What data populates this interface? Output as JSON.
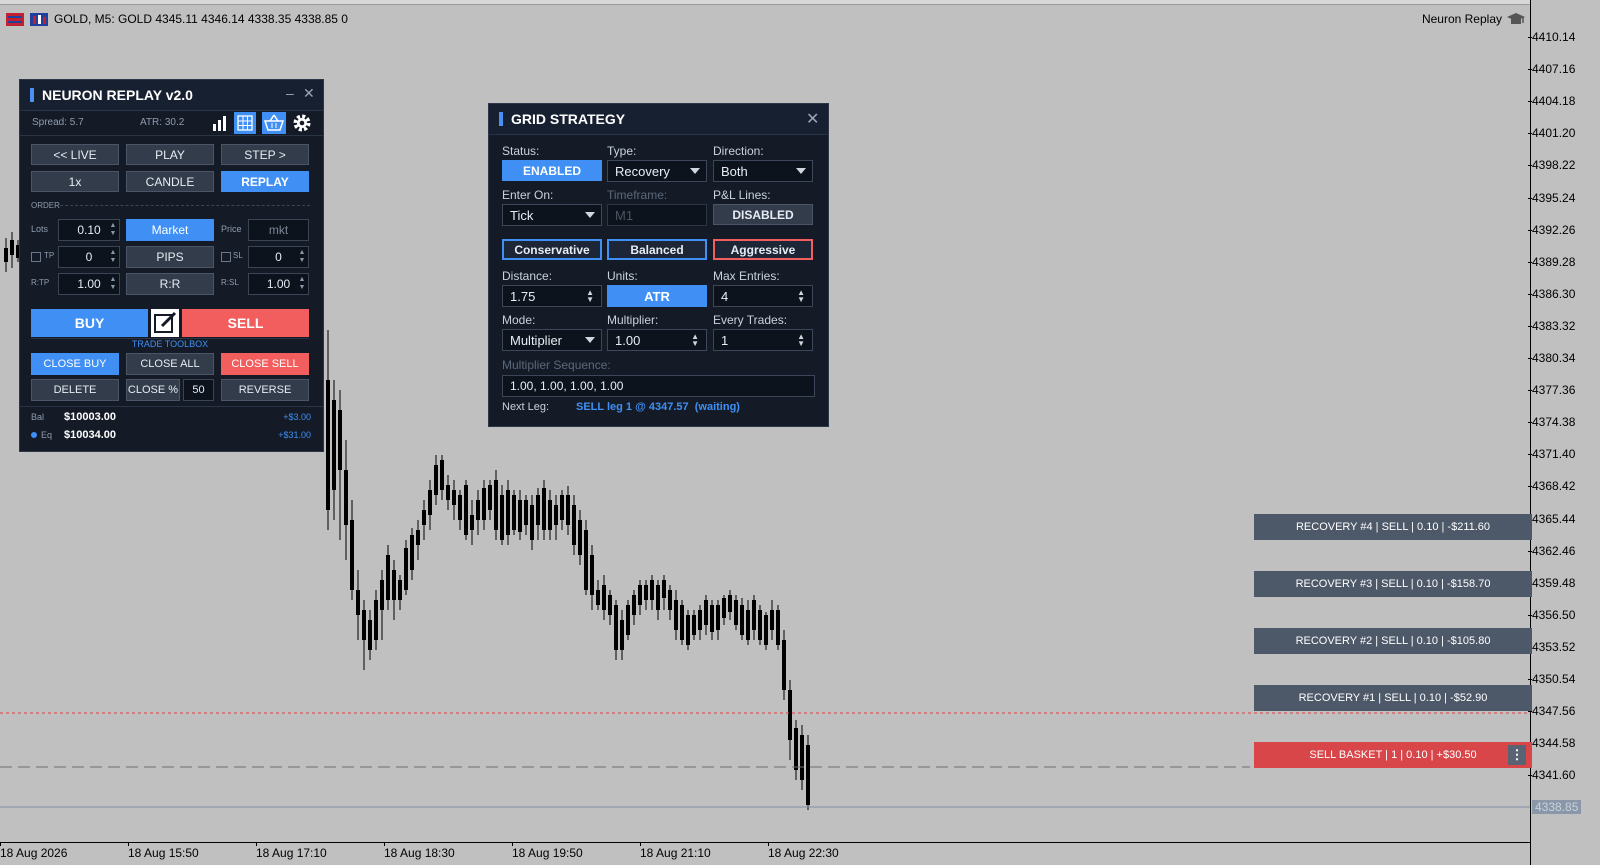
{
  "chart": {
    "symbol_line": "GOLD, M5:  GOLD  4345.11 4346.14 4338.35 4338.85  0",
    "indicator_name": "Neuron Replay",
    "current_price": "4338.85",
    "price_ticks": [
      "4410.14",
      "4407.16",
      "4404.18",
      "4401.20",
      "4398.22",
      "4395.24",
      "4392.26",
      "4389.28",
      "4386.30",
      "4383.32",
      "4380.34",
      "4377.36",
      "4374.38",
      "4371.40",
      "4368.42",
      "4365.44",
      "4362.46",
      "4359.48",
      "4356.50",
      "4353.52",
      "4350.54",
      "4347.56",
      "4344.58",
      "4341.60"
    ],
    "time_ticks": [
      "18 Aug 2026",
      "18 Aug 15:50",
      "18 Aug 17:10",
      "18 Aug 18:30",
      "18 Aug 19:50",
      "18 Aug 21:10",
      "18 Aug 22:30"
    ],
    "colors": {
      "bull": "#1f3fcf",
      "bear": "#000000",
      "background": "#c0c0c0",
      "sell_line": "#e04040"
    }
  },
  "neuron_panel": {
    "title": "NEURON REPLAY v2.0",
    "spread": "Spread: 5.7",
    "atr": "ATR: 30.2",
    "live_btn": "<< LIVE",
    "play_btn": "PLAY",
    "step_btn": "STEP >",
    "speed_btn": "1x",
    "candle_btn": "CANDLE",
    "replay_btn": "REPLAY",
    "order_section": "ORDER",
    "lots_label": "Lots",
    "lots_value": "0.10",
    "market_btn": "Market",
    "price_label": "Price",
    "price_value": "mkt",
    "tp_label": "TP",
    "tp_value": "0",
    "pips_btn": "PIPS",
    "sl_label": "SL",
    "sl_value": "0",
    "rtp_label": "R:TP",
    "rtp_value": "1.00",
    "rr_btn": "R:R",
    "rsl_label": "R:SL",
    "rsl_value": "1.00",
    "buy_btn": "BUY",
    "sell_btn": "SELL",
    "toolbox_label": "TRADE TOOLBOX",
    "close_buy_btn": "CLOSE BUY",
    "close_all_btn": "CLOSE ALL",
    "close_sell_btn": "CLOSE SELL",
    "delete_btn": "DELETE",
    "close_pct_btn": "CLOSE %",
    "close_pct_value": "50",
    "reverse_btn": "REVERSE",
    "bal_label": "Bal",
    "bal_value": "$10003.00",
    "bal_change": "+$3.00",
    "eq_label": "Eq",
    "eq_value": "$10034.00",
    "eq_change": "+$31.00"
  },
  "grid_panel": {
    "title": "GRID STRATEGY",
    "status_label": "Status:",
    "status_value": "ENABLED",
    "type_label": "Type:",
    "type_value": "Recovery",
    "direction_label": "Direction:",
    "direction_value": "Both",
    "enter_on_label": "Enter On:",
    "enter_on_value": "Tick",
    "timeframe_label": "Timeframe:",
    "timeframe_value": "M1",
    "pl_lines_label": "P&L Lines:",
    "pl_lines_value": "DISABLED",
    "conservative_btn": "Conservative",
    "balanced_btn": "Balanced",
    "aggressive_btn": "Aggressive",
    "distance_label": "Distance:",
    "distance_value": "1.75",
    "units_label": "Units:",
    "units_value": "ATR",
    "max_entries_label": "Max Entries:",
    "max_entries_value": "4",
    "mode_label": "Mode:",
    "mode_value": "Multiplier",
    "multiplier_label": "Multiplier:",
    "multiplier_value": "1.00",
    "every_trades_label": "Every Trades:",
    "every_trades_value": "1",
    "sequence_label": "Multiplier Sequence:",
    "sequence_value": "1.00, 1.00, 1.00, 1.00",
    "next_leg_label": "Next Leg:",
    "next_leg_value": "SELL leg 1 @ 4347.57  (waiting)"
  },
  "recovery_labels": [
    "RECOVERY #4 | SELL | 0.10 | -$211.60",
    "RECOVERY #3 | SELL | 0.10 | -$158.70",
    "RECOVERY #2 | SELL | 0.10 | -$105.80",
    "RECOVERY #1 | SELL | 0.10 | -$52.90"
  ],
  "sell_basket": "SELL BASKET | 1 | 0.10 | +$30.50"
}
